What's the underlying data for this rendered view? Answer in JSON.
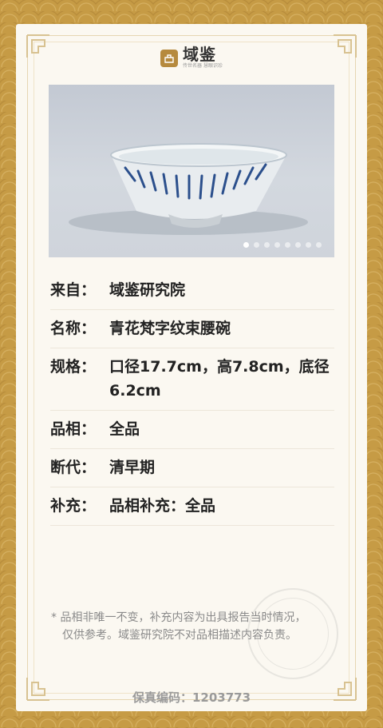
{
  "logo": {
    "name": "域鉴",
    "subtitle": "传世名器 慧眼识珍"
  },
  "carousel": {
    "total_slides": 8,
    "active_index": 0
  },
  "details": [
    {
      "label": "来自：",
      "value": "域鉴研究院"
    },
    {
      "label": "名称：",
      "value": "青花梵字纹束腰碗"
    },
    {
      "label": "规格：",
      "value": "口径17.7cm，高7.8cm，底径6.2cm"
    },
    {
      "label": "品相：",
      "value": "全品"
    },
    {
      "label": "断代：",
      "value": "清早期"
    },
    {
      "label": "补充：",
      "value": "品相补充：全品"
    }
  ],
  "note": {
    "line1": "* 品相非唯一不变，补充内容为出具报告当时情况，",
    "line2": "仅供参考。域鉴研究院不对品相描述内容负责。"
  },
  "serial": "保真编码：1203773",
  "colors": {
    "frame_gold": "#c69b45",
    "card_bg": "#fbf8f1",
    "logo_gold": "#b68a3e"
  }
}
